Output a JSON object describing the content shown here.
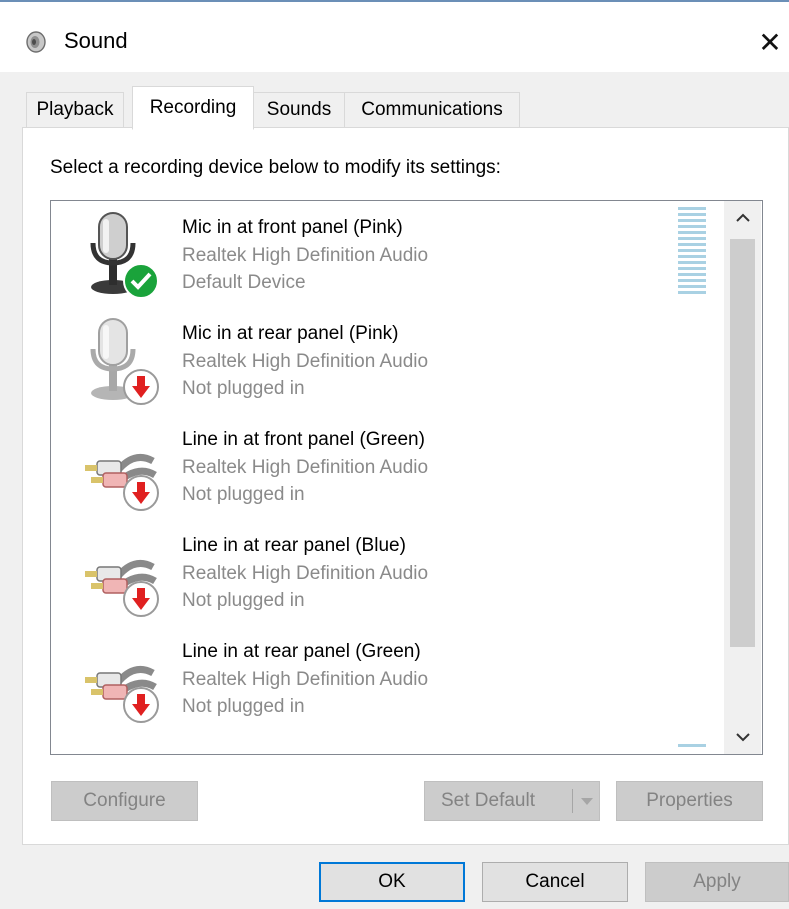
{
  "window": {
    "title": "Sound",
    "close_glyph": "✕",
    "icon": "speaker-icon"
  },
  "tabs": [
    {
      "label": "Playback",
      "active": false
    },
    {
      "label": "Recording",
      "active": true
    },
    {
      "label": "Sounds",
      "active": false
    },
    {
      "label": "Communications",
      "active": false
    }
  ],
  "panel": {
    "instruction": "Select a recording device below to modify its settings:"
  },
  "devices": [
    {
      "name": "Mic in at front panel (Pink)",
      "driver": "Realtek High Definition Audio",
      "status": "Default Device",
      "icon": "microphone-icon",
      "badge": "default-check-badge"
    },
    {
      "name": "Mic in at rear panel (Pink)",
      "driver": "Realtek High Definition Audio",
      "status": "Not plugged in",
      "icon": "microphone-icon",
      "badge": "not-plugged-badge"
    },
    {
      "name": "Line in at front panel (Green)",
      "driver": "Realtek High Definition Audio",
      "status": "Not plugged in",
      "icon": "rca-cable-icon",
      "badge": "not-plugged-badge"
    },
    {
      "name": "Line in at rear panel (Blue)",
      "driver": "Realtek High Definition Audio",
      "status": "Not plugged in",
      "icon": "rca-cable-icon",
      "badge": "not-plugged-badge"
    },
    {
      "name": "Line in at rear panel (Green)",
      "driver": "Realtek High Definition Audio",
      "status": "Not plugged in",
      "icon": "rca-cable-icon",
      "badge": "not-plugged-badge"
    }
  ],
  "buttons": {
    "configure": "Configure",
    "set_default": "Set Default",
    "properties": "Properties",
    "ok": "OK",
    "cancel": "Cancel",
    "apply": "Apply"
  },
  "colors": {
    "accent": "#0078d7",
    "meter": "#a9d1e3",
    "check_badge": "#1aa33b",
    "unplugged_badge": "#e02020"
  }
}
